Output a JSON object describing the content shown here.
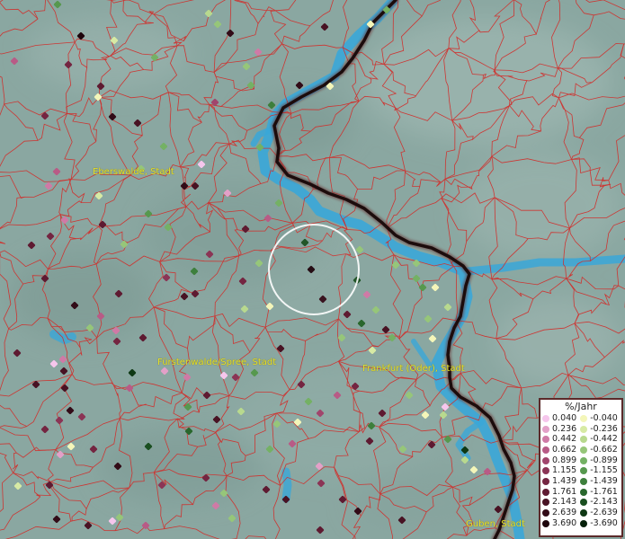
{
  "cities": [
    {
      "name": "Eberswalde, Stadt"
    },
    {
      "name": "Fürstenwalde/Spree, Stadt"
    },
    {
      "name": "Frankfurt (Oder), Stadt"
    },
    {
      "name": "Guben, Stadt"
    }
  ],
  "legend": {
    "title": "%/Jahr",
    "positive": [
      {
        "value": "0.040",
        "color": "#f6c6ec"
      },
      {
        "value": "0.236",
        "color": "#e3a0c8"
      },
      {
        "value": "0.442",
        "color": "#cf7aa6"
      },
      {
        "value": "0.662",
        "color": "#b85b86"
      },
      {
        "value": "0.899",
        "color": "#a1456c"
      },
      {
        "value": "1.155",
        "color": "#8b3455"
      },
      {
        "value": "1.439",
        "color": "#742541"
      },
      {
        "value": "1.761",
        "color": "#5e1a31"
      },
      {
        "value": "2.143",
        "color": "#481223"
      },
      {
        "value": "2.639",
        "color": "#320b17"
      },
      {
        "value": "3.690",
        "color": "#1e050c"
      }
    ],
    "negative": [
      {
        "value": "-0.040",
        "color": "#f4f6b9"
      },
      {
        "value": "-0.236",
        "color": "#d7eaa4"
      },
      {
        "value": "-0.442",
        "color": "#b8d98e"
      },
      {
        "value": "-0.662",
        "color": "#96c679"
      },
      {
        "value": "-0.899",
        "color": "#74b164"
      },
      {
        "value": "-1.155",
        "color": "#56984e"
      },
      {
        "value": "-1.439",
        "color": "#3d7f3c"
      },
      {
        "value": "-1.761",
        "color": "#29672d"
      },
      {
        "value": "-2.143",
        "color": "#1a4f20"
      },
      {
        "value": "-2.639",
        "color": "#0e3814"
      },
      {
        "value": "-3.690",
        "color": "#05210a"
      }
    ]
  },
  "colors": {
    "terrain": "#8aa7a1",
    "river": "#3aa7d8",
    "borders": "#d0302d",
    "state_border": "#2a1010",
    "label": "#e6e02a"
  }
}
